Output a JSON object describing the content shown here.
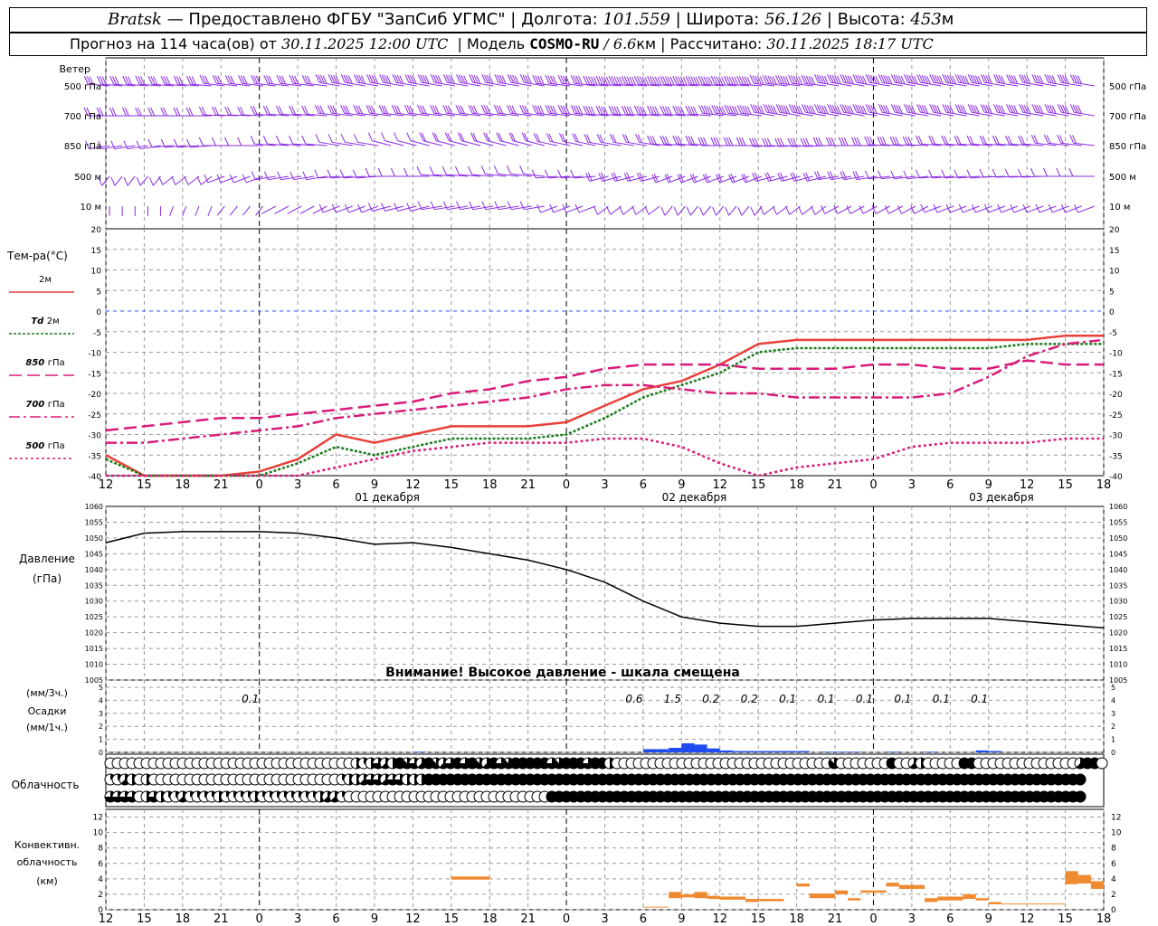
{
  "header": {
    "station": "Bratsk",
    "dash": "—",
    "provided": "Предоставлено ФГБУ \"ЗапСиб УГМС\"",
    "lon_label": "Долгота:",
    "lon": "101.559",
    "lat_label": "Широта:",
    "lat": "56.126",
    "alt_label": "Высота:",
    "alt": "453",
    "alt_unit": "м",
    "forecast_label": "Прогноз на 114 часа(ов) от",
    "forecast_start": "30.11.2025 12:00 UTC",
    "model_label": "Модель",
    "model": "COSMO-RU",
    "model_res": "/ 6.6",
    "model_res_unit": "км",
    "computed_label": "Рассчитано:",
    "computed": "30.11.2025 18:17 UTC"
  },
  "colors": {
    "wind": "#8a2be2",
    "t2m": "#e8413c",
    "td2m": "#1a7a1a",
    "t850": "#d81b7a",
    "t700": "#d81b7a",
    "t500": "#d81b7a",
    "pressure": "#000000",
    "precip": "#1e4cf0",
    "convective": "#f08a30",
    "zero_line": "#3355ff",
    "grid": "#999999"
  },
  "wind_panel": {
    "title": "Ветер",
    "levels": [
      "500 гПа",
      "700 гПа",
      "850 гПа",
      "500 м",
      "10 м"
    ]
  },
  "temp_panel": {
    "title": "Тем-ра(°C)",
    "legend": [
      {
        "key": "t2m",
        "prefix": "",
        "label": "2м"
      },
      {
        "key": "td2m",
        "prefix": "Td",
        "label": "2м"
      },
      {
        "key": "t850",
        "prefix": "850",
        "label": "гПа"
      },
      {
        "key": "t700",
        "prefix": "700",
        "label": "гПа"
      },
      {
        "key": "t500",
        "prefix": "500",
        "label": "гПа"
      }
    ],
    "ticks": [
      20,
      15,
      10,
      5,
      0,
      -5,
      -10,
      -15,
      -20,
      -25,
      -30,
      -35,
      -40
    ]
  },
  "time_axis": {
    "hour_labels": [
      "12",
      "15",
      "18",
      "21",
      "0",
      "3",
      "6",
      "9",
      "12",
      "15",
      "18",
      "21",
      "0",
      "3",
      "6",
      "9",
      "12",
      "15",
      "18",
      "21",
      "0",
      "3",
      "6",
      "9",
      "12",
      "15",
      "18"
    ],
    "day_labels": [
      "01 декабря",
      "02 декабря",
      "03 декабря"
    ]
  },
  "pressure_panel": {
    "title": "Давление",
    "unit": "(гПа)",
    "ticks": [
      1060,
      1055,
      1050,
      1045,
      1040,
      1035,
      1030,
      1025,
      1020,
      1015,
      1010,
      1005
    ],
    "warning": "Внимание! Высокое давление - шкала смещена"
  },
  "precip_panel": {
    "title_top": "(мм/3ч.)",
    "title_mid": "Осадки",
    "title_bot": "(мм/1ч.)",
    "ticks": [
      5,
      4,
      3,
      2,
      1,
      0
    ],
    "totals": [
      {
        "hour": 12,
        "text": "0.1"
      },
      {
        "hour": 42,
        "text": "0.6"
      },
      {
        "hour": 45,
        "text": "1.5"
      },
      {
        "hour": 48,
        "text": "0.2"
      },
      {
        "hour": 51,
        "text": "0.2"
      },
      {
        "hour": 54,
        "text": "0.1"
      },
      {
        "hour": 57,
        "text": "0.1"
      },
      {
        "hour": 60,
        "text": "0.1"
      },
      {
        "hour": 63,
        "text": "0.1"
      },
      {
        "hour": 66,
        "text": "0.1"
      },
      {
        "hour": 69,
        "text": "0.1"
      }
    ]
  },
  "cloud_panel": {
    "title": "Облачность"
  },
  "conv_panel": {
    "title1": "Конвективн.",
    "title2": "облачность",
    "title3": "(км)",
    "ticks": [
      12,
      10,
      8,
      6,
      4,
      2,
      0
    ]
  },
  "chart_data": [
    {
      "type": "line",
      "name": "temperature",
      "x_hours": [
        0,
        3,
        6,
        9,
        12,
        15,
        18,
        21,
        24,
        27,
        30,
        33,
        36,
        39,
        42,
        45,
        48,
        51,
        54,
        57,
        60,
        63,
        66,
        69,
        72,
        75,
        78
      ],
      "ylim": [
        -40,
        20
      ],
      "series": [
        {
          "name": "2м",
          "key": "t2m",
          "values": [
            -35,
            -41,
            -41,
            -40,
            -39,
            -36,
            -30,
            -32,
            -30,
            -28,
            -28,
            -28,
            -27,
            -23,
            -19,
            -17,
            -13,
            -8,
            -7,
            -7,
            -7,
            -7,
            -7,
            -7,
            -7,
            -6,
            -6
          ]
        },
        {
          "name": "Td 2м",
          "key": "td2m",
          "values": [
            -36,
            -42,
            -42,
            -41,
            -40,
            -37,
            -33,
            -35,
            -33,
            -31,
            -31,
            -31,
            -30,
            -26,
            -21,
            -18,
            -15,
            -10,
            -9,
            -9,
            -9,
            -9,
            -9,
            -9,
            -8,
            -8,
            -8
          ]
        },
        {
          "name": "850 гПа",
          "key": "t850",
          "values": [
            -29,
            -28,
            -27,
            -26,
            -26,
            -25,
            -24,
            -23,
            -22,
            -20,
            -19,
            -17,
            -16,
            -14,
            -13,
            -13,
            -13,
            -14,
            -14,
            -14,
            -13,
            -13,
            -14,
            -14,
            -12,
            -13,
            -13
          ]
        },
        {
          "name": "700 гПа",
          "key": "t700",
          "values": [
            -32,
            -32,
            -31,
            -30,
            -29,
            -28,
            -26,
            -25,
            -24,
            -23,
            -22,
            -21,
            -19,
            -18,
            -18,
            -19,
            -20,
            -20,
            -21,
            -21,
            -21,
            -21,
            -20,
            -16,
            -11,
            -8,
            -7
          ]
        },
        {
          "name": "500 гПа",
          "key": "t500",
          "values": [
            -42,
            -43,
            -43,
            -42,
            -41,
            -40,
            -38,
            -36,
            -34,
            -33,
            -32,
            -32,
            -32,
            -31,
            -31,
            -33,
            -37,
            -40,
            -38,
            -37,
            -36,
            -33,
            -32,
            -32,
            -32,
            -31,
            -31
          ]
        }
      ]
    },
    {
      "type": "line",
      "name": "pressure",
      "x_hours": [
        0,
        3,
        6,
        9,
        12,
        15,
        18,
        21,
        24,
        27,
        30,
        33,
        36,
        39,
        42,
        45,
        48,
        51,
        54,
        57,
        60,
        63,
        66,
        69,
        72,
        75,
        78
      ],
      "ylim": [
        1005,
        1060
      ],
      "series": [
        {
          "name": "Давление",
          "key": "pressure",
          "values": [
            1048.5,
            1051.5,
            1052,
            1052,
            1052,
            1051.5,
            1050,
            1048,
            1048.5,
            1047,
            1045,
            1043,
            1040,
            1036,
            1030,
            1025,
            1023,
            1022,
            1022,
            1023,
            1024,
            1024.5,
            1024.5,
            1024.5,
            1023.5,
            1022.5,
            1021.5
          ]
        }
      ]
    },
    {
      "type": "bar",
      "name": "precipitation_1h",
      "ylim": [
        0,
        5
      ],
      "x_hours": [
        24,
        42,
        43,
        44,
        45,
        46,
        47,
        48,
        49,
        50,
        51,
        52,
        53,
        54,
        56,
        57,
        58,
        61,
        64,
        68,
        69
      ],
      "values": [
        0.05,
        0.25,
        0.25,
        0.35,
        0.7,
        0.6,
        0.3,
        0.15,
        0.1,
        0.1,
        0.1,
        0.1,
        0.1,
        0.1,
        0.05,
        0.05,
        0.05,
        0.05,
        0.05,
        0.15,
        0.1
      ]
    },
    {
      "type": "table",
      "name": "cloud_cover_octas",
      "rows": [
        "upper",
        "middle",
        "lower"
      ],
      "x_start_hour": 0,
      "step_hours": 1,
      "upper": [
        0,
        0,
        0,
        0,
        0,
        0,
        0,
        0,
        0,
        0,
        0,
        0,
        0,
        0,
        0,
        0,
        0,
        0,
        0,
        0,
        0,
        0,
        0,
        0,
        0,
        0,
        0,
        0,
        0,
        0,
        0,
        0,
        0,
        0,
        4,
        3,
        4,
        6,
        5,
        4,
        8,
        7,
        6,
        5,
        8,
        7,
        5,
        6,
        8,
        6,
        8,
        7,
        5,
        8,
        6,
        7,
        8,
        8,
        8,
        8,
        8,
        6,
        7,
        8,
        8,
        8,
        6,
        8,
        8,
        4,
        0,
        0,
        0,
        0,
        0,
        0,
        0,
        0,
        0,
        0,
        0,
        0,
        0,
        0,
        0,
        0,
        0,
        0,
        0,
        0,
        0,
        0,
        0,
        0,
        0,
        0,
        0,
        0,
        0,
        0,
        7,
        0,
        0,
        0,
        0,
        0,
        0,
        0,
        8,
        0,
        0,
        5,
        4,
        0,
        0,
        0,
        0,
        0,
        8,
        8,
        0,
        0,
        0,
        0,
        0,
        0,
        0,
        0,
        0,
        0,
        0,
        0,
        0,
        0,
        5,
        8,
        8,
        0,
        0
      ],
      "middle": [
        2,
        3,
        5,
        4,
        0,
        4,
        0,
        0,
        0,
        0,
        0,
        0,
        0,
        0,
        0,
        0,
        0,
        0,
        0,
        0,
        0,
        0,
        0,
        0,
        0,
        0,
        0,
        0,
        0,
        0,
        0,
        0,
        3,
        4,
        4,
        5,
        6,
        6,
        5,
        6,
        6,
        4,
        4,
        4,
        8,
        8,
        8,
        8,
        8,
        8,
        8,
        8,
        8,
        8,
        8,
        8,
        8,
        8,
        8,
        8,
        8,
        8,
        8,
        8,
        8,
        8,
        8,
        8,
        8,
        8,
        8,
        8,
        8,
        8,
        8,
        8,
        8,
        8,
        8,
        8,
        8,
        8,
        8,
        8,
        8,
        8,
        8,
        8,
        8,
        8,
        8,
        8,
        8,
        8,
        8,
        8,
        8,
        8,
        8,
        8,
        8,
        8,
        8,
        8,
        8,
        8,
        8,
        8,
        8,
        8,
        8,
        8,
        8,
        8,
        8,
        8,
        8,
        8,
        8,
        8,
        8,
        8,
        8,
        8,
        8,
        8,
        8,
        8,
        8,
        8,
        8,
        8,
        8,
        8,
        8
      ],
      "lower": [
        6,
        6,
        6,
        6,
        0,
        4,
        6,
        4,
        3,
        3,
        5,
        2,
        3,
        3,
        2,
        4,
        2,
        3,
        2,
        3,
        4,
        2,
        3,
        3,
        3,
        3,
        3,
        3,
        3,
        4,
        5,
        5,
        2,
        0,
        0,
        0,
        0,
        0,
        0,
        0,
        0,
        0,
        0,
        0,
        0,
        0,
        0,
        0,
        0,
        0,
        0,
        0,
        0,
        0,
        0,
        0,
        0,
        0,
        0,
        0,
        0,
        8,
        8,
        8,
        8,
        8,
        8,
        8,
        8,
        8,
        8,
        8,
        8,
        8,
        8,
        8,
        8,
        8,
        8,
        8,
        8,
        8,
        8,
        8,
        8,
        8,
        8,
        8,
        8,
        8,
        8,
        8,
        8,
        8,
        8,
        8,
        8,
        8,
        8,
        8,
        8,
        8,
        8,
        8,
        8,
        8,
        8,
        8,
        8,
        8,
        8,
        8,
        8,
        8,
        8,
        8,
        8,
        8,
        8,
        8,
        8,
        8,
        8,
        8,
        8,
        8,
        8,
        8,
        8,
        8,
        8,
        8,
        8,
        8,
        8
      ]
    },
    {
      "type": "bar",
      "name": "convective_cloud_km",
      "ylim": [
        0,
        13
      ],
      "segments": [
        {
          "h0": 27,
          "h1": 30,
          "base": 3.9,
          "top": 4.3
        },
        {
          "h0": 42,
          "h1": 44,
          "base": 0.3,
          "top": 0.4
        },
        {
          "h0": 44,
          "h1": 45,
          "base": 1.5,
          "top": 2.3
        },
        {
          "h0": 45,
          "h1": 46,
          "base": 1.6,
          "top": 2.0
        },
        {
          "h0": 46,
          "h1": 47,
          "base": 1.5,
          "top": 2.3
        },
        {
          "h0": 47,
          "h1": 48,
          "base": 1.4,
          "top": 1.8
        },
        {
          "h0": 48,
          "h1": 50,
          "base": 1.3,
          "top": 1.7
        },
        {
          "h0": 50,
          "h1": 51,
          "base": 1.0,
          "top": 1.4
        },
        {
          "h0": 51,
          "h1": 53,
          "base": 1.1,
          "top": 1.4
        },
        {
          "h0": 54,
          "h1": 55,
          "base": 3.0,
          "top": 3.4
        },
        {
          "h0": 55,
          "h1": 57,
          "base": 1.5,
          "top": 2.1
        },
        {
          "h0": 57,
          "h1": 58,
          "base": 2.0,
          "top": 2.5
        },
        {
          "h0": 58,
          "h1": 59,
          "base": 1.2,
          "top": 1.5
        },
        {
          "h0": 59,
          "h1": 61,
          "base": 2.2,
          "top": 2.5
        },
        {
          "h0": 61,
          "h1": 62,
          "base": 3.0,
          "top": 3.5
        },
        {
          "h0": 62,
          "h1": 64,
          "base": 2.7,
          "top": 3.2
        },
        {
          "h0": 64,
          "h1": 65,
          "base": 1.0,
          "top": 1.5
        },
        {
          "h0": 65,
          "h1": 67,
          "base": 1.2,
          "top": 1.7
        },
        {
          "h0": 67,
          "h1": 68,
          "base": 1.4,
          "top": 2.0
        },
        {
          "h0": 68,
          "h1": 69,
          "base": 1.2,
          "top": 1.5
        },
        {
          "h0": 69,
          "h1": 70,
          "base": 0.7,
          "top": 1.0
        },
        {
          "h0": 70,
          "h1": 75,
          "base": 0.7,
          "top": 0.8
        },
        {
          "h0": 75,
          "h1": 76,
          "base": 3.3,
          "top": 5.0
        },
        {
          "h0": 76,
          "h1": 77,
          "base": 3.4,
          "top": 4.5
        },
        {
          "h0": 77,
          "h1": 78,
          "base": 2.7,
          "top": 3.7
        }
      ]
    },
    {
      "type": "scatter",
      "name": "wind_barbs",
      "levels": [
        "500 гПа",
        "700 гПа",
        "850 гПа",
        "500 м",
        "10 м"
      ],
      "x_start_hour": 0,
      "step_hours": 1,
      "direction_deg": {
        "500 гПа": [
          280,
          280,
          285,
          285,
          290,
          290,
          290,
          290,
          285,
          280,
          280,
          280,
          285,
          290,
          290,
          290,
          290,
          290
        ],
        "700 гПа": [
          270,
          270,
          275,
          280,
          285,
          285,
          285,
          285,
          285,
          280,
          280,
          285,
          290,
          290,
          290,
          290,
          290,
          290
        ],
        "850 гПа": [
          250,
          260,
          270,
          280,
          290,
          300,
          300,
          300,
          295,
          290,
          280,
          270,
          265,
          270,
          275,
          280,
          280,
          285
        ],
        "500 м": [
          200,
          210,
          230,
          250,
          260,
          270,
          280,
          285,
          260,
          240,
          230,
          230,
          240,
          250,
          255,
          260,
          265,
          270
        ],
        "10 м": [
          180,
          190,
          200,
          220,
          230,
          240,
          250,
          250,
          230,
          210,
          200,
          200,
          210,
          220,
          220,
          230,
          230,
          230
        ]
      },
      "speed_ms": {
        "500 гПа": [
          15,
          15,
          16,
          17,
          18,
          19,
          20,
          21,
          22,
          24,
          26,
          28,
          30,
          28,
          26,
          24,
          22,
          22
        ],
        "700 гПа": [
          10,
          10,
          11,
          12,
          13,
          14,
          15,
          16,
          18,
          20,
          22,
          24,
          25,
          24,
          22,
          20,
          19,
          19
        ],
        "850 гПа": [
          5,
          5,
          5,
          6,
          6,
          7,
          8,
          9,
          10,
          12,
          14,
          15,
          15,
          14,
          13,
          12,
          11,
          11
        ],
        "500 м": [
          3,
          3,
          3,
          4,
          4,
          5,
          6,
          6,
          7,
          8,
          9,
          10,
          9,
          8,
          7,
          6,
          5,
          5
        ],
        "10 м": [
          2,
          2,
          2,
          2,
          3,
          3,
          3,
          4,
          4,
          5,
          5,
          6,
          5,
          4,
          4,
          3,
          3,
          3
        ]
      }
    }
  ]
}
